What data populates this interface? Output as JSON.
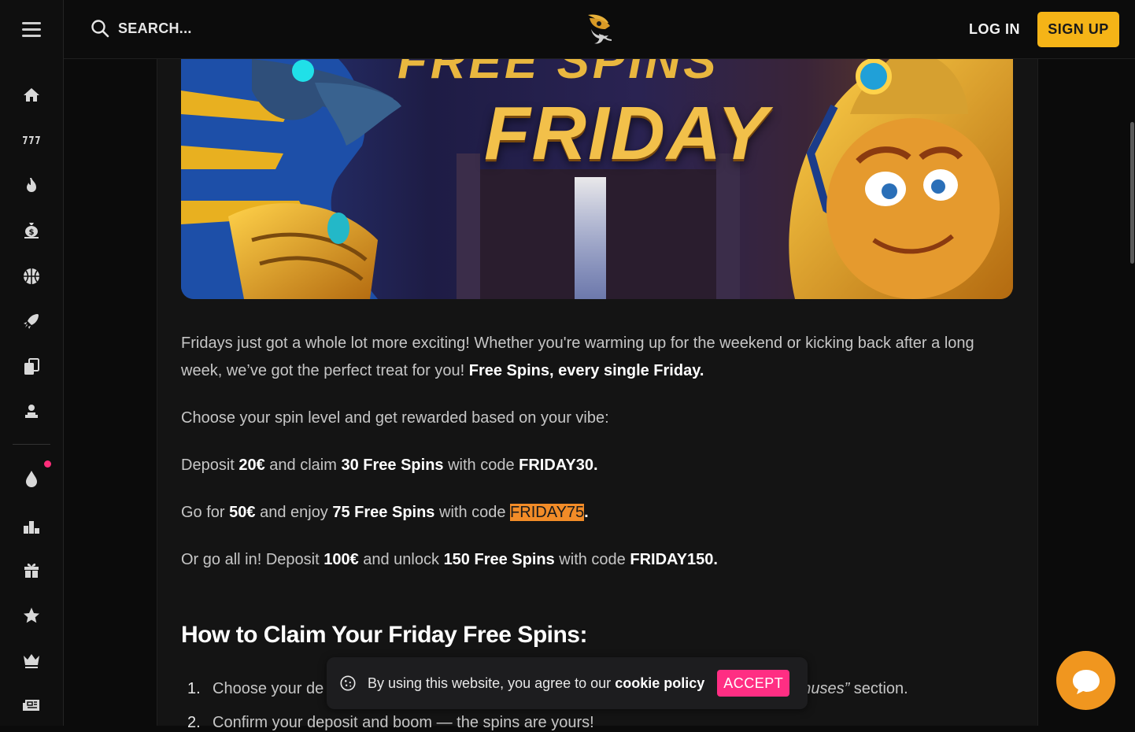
{
  "topbar": {
    "search_label": "SEARCH...",
    "login_label": "LOG IN",
    "signup_label": "SIGN UP"
  },
  "sidebar": {
    "items": [
      {
        "icon": "home-icon"
      },
      {
        "icon": "slots-777-icon"
      },
      {
        "icon": "fire-icon"
      },
      {
        "icon": "money-bag-icon"
      },
      {
        "icon": "basketball-icon"
      },
      {
        "icon": "rocket-icon"
      },
      {
        "icon": "cards-icon"
      },
      {
        "icon": "dealer-icon"
      },
      {
        "icon": "drop-icon"
      },
      {
        "icon": "leaderboard-icon"
      },
      {
        "icon": "gift-icon"
      },
      {
        "icon": "star-icon"
      },
      {
        "icon": "crown-icon"
      },
      {
        "icon": "news-icon"
      }
    ]
  },
  "banner": {
    "title_top": "FREE SPINS",
    "title": "FRIDAY"
  },
  "article": {
    "intro_1": "Fridays just got a whole lot more exciting! Whether you're warming up for the weekend or kicking back after a long week, we’ve got the perfect treat for you! ",
    "intro_bold": "Free Spins, every single Friday.",
    "choose": "Choose your spin level and get rewarded based on your vibe:",
    "tier1": {
      "pre": "Deposit ",
      "amount": "20€",
      "mid": " and claim ",
      "spins": "30 Free Spins",
      "code_pre": " with code ",
      "code": "FRIDAY30."
    },
    "tier2": {
      "pre": "Go for ",
      "amount": "50€",
      "mid": " and enjoy ",
      "spins": "75 Free Spins",
      "code_pre": " with code ",
      "code": "FRIDAY75",
      "post": "."
    },
    "tier3": {
      "pre": "Or go all in! Deposit ",
      "amount": "100€",
      "mid": " and unlock ",
      "spins": "150 Free Spins",
      "code_pre": " with code ",
      "code": "FRIDAY150."
    },
    "heading": "How to Claim Your Friday Free Spins:",
    "steps": [
      {
        "num": "1.",
        "text_start": "Choose your de",
        "text_italic": "nuses”",
        "text_end": " section."
      },
      {
        "num": "2.",
        "text": "Confirm your deposit and boom — the spins are yours!"
      }
    ]
  },
  "cookie": {
    "text": "By using this website, you agree to our ",
    "link": "cookie policy",
    "accept": "ACCEPT"
  },
  "colors": {
    "accent_yellow": "#f5b417",
    "accept_pink": "#ff2e83",
    "code_highlight": "#f28c28",
    "chat_orange": "#f0961f"
  }
}
